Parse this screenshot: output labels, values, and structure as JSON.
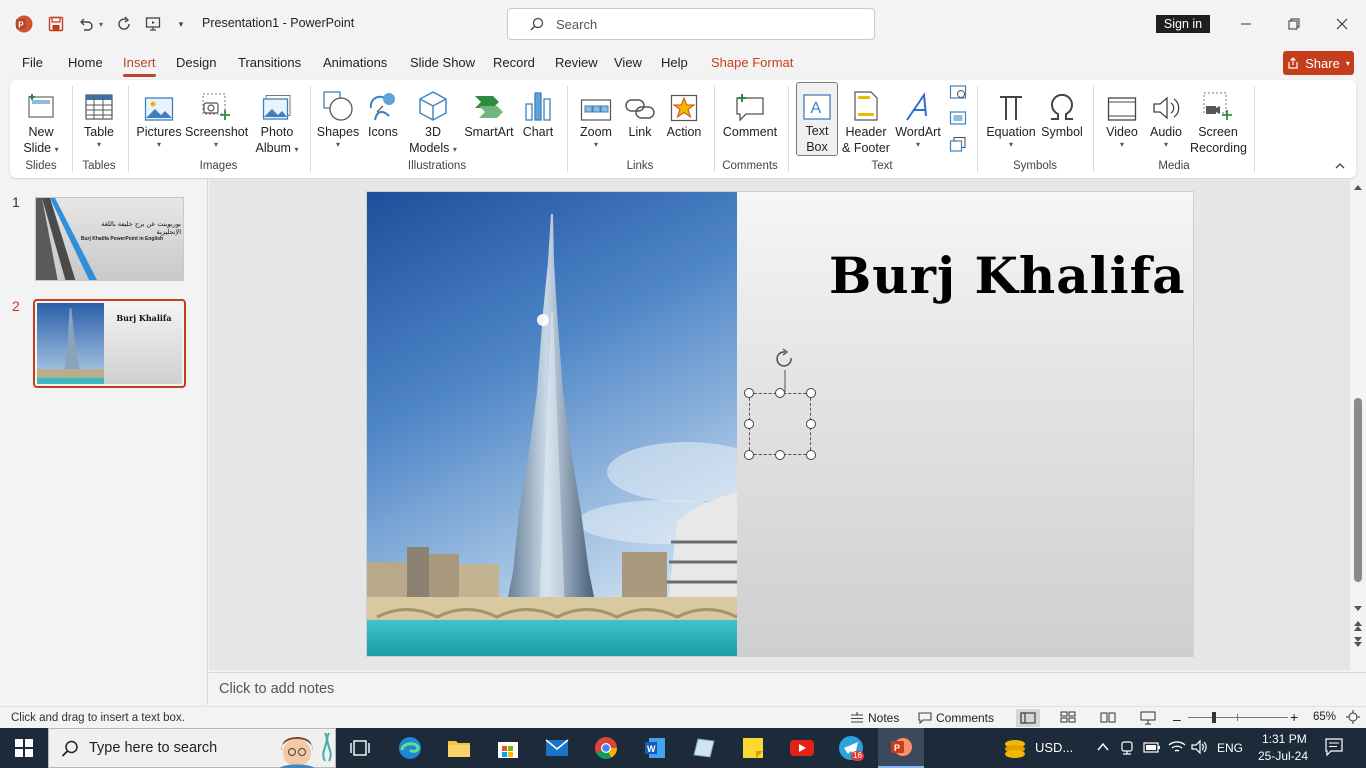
{
  "app": {
    "title": "Presentation1  -  PowerPoint",
    "brand_color": "#c43e1c"
  },
  "titlebar": {
    "search_placeholder": "Search",
    "signin_label": "Sign in"
  },
  "tabs": [
    {
      "label": "File"
    },
    {
      "label": "Home"
    },
    {
      "label": "Insert",
      "active": true
    },
    {
      "label": "Design"
    },
    {
      "label": "Transitions"
    },
    {
      "label": "Animations"
    },
    {
      "label": "Slide Show"
    },
    {
      "label": "Record"
    },
    {
      "label": "Review"
    },
    {
      "label": "View"
    },
    {
      "label": "Help"
    },
    {
      "label": "Shape Format"
    }
  ],
  "share_label": "Share",
  "ribbon": {
    "new_slide": [
      "New",
      "Slide"
    ],
    "table": "Table",
    "pictures": "Pictures",
    "screenshot": "Screenshot",
    "photo_album": [
      "Photo",
      "Album"
    ],
    "shapes": "Shapes",
    "icons": "Icons",
    "models_3d": [
      "3D",
      "Models"
    ],
    "smartart": "SmartArt",
    "chart": "Chart",
    "zoom": "Zoom",
    "link": "Link",
    "action": "Action",
    "comment": "Comment",
    "text_box": [
      "Text",
      "Box"
    ],
    "header_footer": [
      "Header",
      "& Footer"
    ],
    "wordart": "WordArt",
    "equation": "Equation",
    "symbol": "Symbol",
    "video": "Video",
    "audio": "Audio",
    "screen_recording": [
      "Screen",
      "Recording"
    ],
    "groups": {
      "slides": "Slides",
      "tables": "Tables",
      "images": "Images",
      "illustrations": "Illustrations",
      "links": "Links",
      "comments": "Comments",
      "text": "Text",
      "symbols": "Symbols",
      "media": "Media"
    }
  },
  "slides": [
    {
      "number": "1",
      "title_ar": "بوربوينت عن برج خليفة باللغة الإنجليزية",
      "subtitle": "Burj Khalifa PowerPoint in English"
    },
    {
      "number": "2",
      "title": "Burj Khalifa",
      "selected": true
    }
  ],
  "current_slide": {
    "title": "Burj Khalifa"
  },
  "notes_placeholder": "Click to add notes",
  "statusbar": {
    "message": "Click and drag to insert a text box.",
    "notes": "Notes",
    "comments": "Comments",
    "zoom": "65%",
    "zoom_fraction": 0.65
  },
  "taskbar": {
    "search_placeholder": "Type here to search",
    "currency": "USD...",
    "language": "ENG",
    "time": "1:31 PM",
    "date": "25-Jul-24",
    "telegram_badge": "16"
  }
}
